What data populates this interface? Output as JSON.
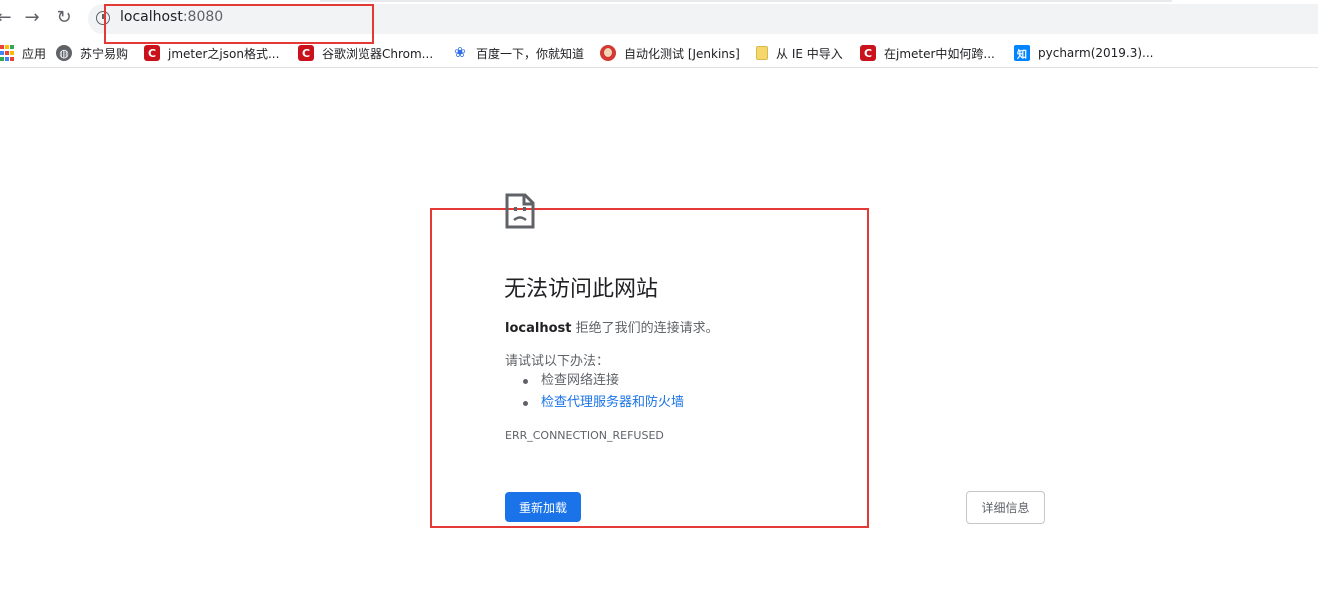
{
  "toolbar": {
    "back_icon": "back-arrow-icon",
    "forward_icon": "forward-arrow-icon",
    "reload_icon": "reload-icon",
    "url_host": "localhost",
    "url_port": ":8080"
  },
  "bookmarks": [
    {
      "label": "应用",
      "icon": "apps-icon"
    },
    {
      "label": "苏宁易购",
      "icon": "globe-icon"
    },
    {
      "label": "jmeter之json格式...",
      "icon": "csdn-icon"
    },
    {
      "label": "谷歌浏览器Chrom...",
      "icon": "csdn-icon"
    },
    {
      "label": "百度一下，你就知道",
      "icon": "baidu-icon"
    },
    {
      "label": "自动化测试 [Jenkins]",
      "icon": "jenkins-icon"
    },
    {
      "label": "从 IE 中导入",
      "icon": "folder-icon"
    },
    {
      "label": "在jmeter中如何跨...",
      "icon": "csdn-icon"
    },
    {
      "label": "pycharm(2019.3)...",
      "icon": "zhihu-icon"
    }
  ],
  "error": {
    "title": "无法访问此网站",
    "host": "localhost",
    "desc_suffix": " 拒绝了我们的连接请求。",
    "suggestions_heading": "请试试以下办法：",
    "suggestions": [
      "检查网络连接",
      "检查代理服务器和防火墙"
    ],
    "code": "ERR_CONNECTION_REFUSED",
    "reload_label": "重新加载",
    "details_label": "详细信息"
  },
  "colors": {
    "accent": "#1a73e8",
    "annotation": "#e53935"
  }
}
